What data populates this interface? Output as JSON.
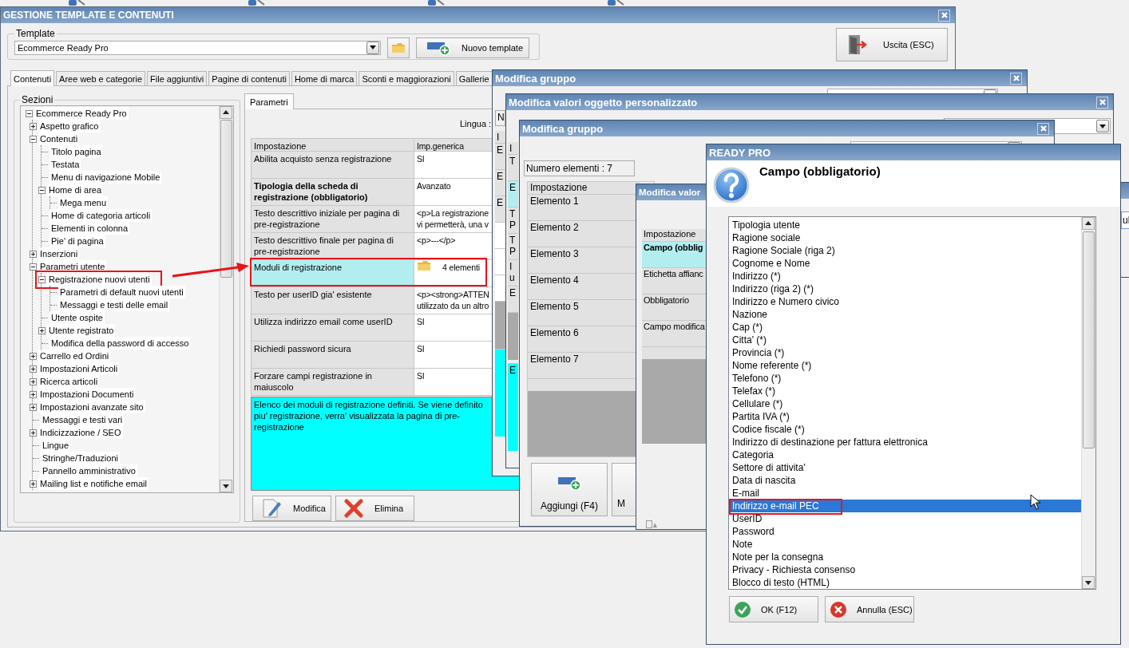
{
  "main_window": {
    "title": "GESTIONE TEMPLATE E CONTENUTI",
    "template": {
      "label": "Template",
      "value": "Ecommerce Ready Pro"
    },
    "new_template_button": "Nuovo template",
    "exit_button": "Uscita (ESC)",
    "tabs": [
      {
        "label": "Contenuti",
        "selected": true
      },
      {
        "label": "Aree web e categorie",
        "selected": false
      },
      {
        "label": "File aggiuntivi",
        "selected": false
      },
      {
        "label": "Pagine di contenuti",
        "selected": false
      },
      {
        "label": "Home di marca",
        "selected": false
      },
      {
        "label": "Sconti e maggiorazioni",
        "selected": false
      },
      {
        "label": "Gallerie",
        "selected": false
      }
    ],
    "sections": {
      "label": "Sezioni",
      "tree": [
        {
          "label": "Ecommerce Ready Pro",
          "expanded": true,
          "annotated": false,
          "children": [
            {
              "label": "Aspetto grafico",
              "expanded": false,
              "annotated": false
            },
            {
              "label": "Contenuti",
              "expanded": true,
              "annotated": false,
              "children": [
                {
                  "label": "Titolo pagina",
                  "annotated": false
                },
                {
                  "label": "Testata",
                  "annotated": false
                },
                {
                  "label": "Menu di navigazione Mobile",
                  "annotated": false
                },
                {
                  "label": "Home di area",
                  "expanded": true,
                  "annotated": false,
                  "children": [
                    {
                      "label": "Mega menu",
                      "annotated": false
                    }
                  ]
                },
                {
                  "label": "Home di categoria articoli",
                  "annotated": false
                },
                {
                  "label": "Elementi in colonna",
                  "annotated": false
                },
                {
                  "label": "Pie' di pagina",
                  "annotated": false
                }
              ]
            },
            {
              "label": "Inserzioni",
              "expanded": false,
              "annotated": false
            },
            {
              "label": "Parametri utente",
              "expanded": true,
              "annotated": false,
              "children": [
                {
                  "label": "Registrazione nuovi utenti",
                  "expanded": true,
                  "annotated": true,
                  "children": [
                    {
                      "label": "Parametri di default nuovi utenti",
                      "annotated": false
                    },
                    {
                      "label": "Messaggi e testi delle email",
                      "annotated": false
                    }
                  ]
                },
                {
                  "label": "Utente ospite",
                  "annotated": false
                },
                {
                  "label": "Utente registrato",
                  "expanded": false,
                  "annotated": false
                },
                {
                  "label": "Modifica della password di accesso",
                  "annotated": false
                }
              ]
            },
            {
              "label": "Carrello ed Ordini",
              "expanded": false,
              "annotated": false
            },
            {
              "label": "Impostazioni Articoli",
              "expanded": false,
              "annotated": false
            },
            {
              "label": "Ricerca articoli",
              "expanded": false,
              "annotated": false
            },
            {
              "label": "Impostazioni Documenti",
              "expanded": false,
              "annotated": false
            },
            {
              "label": "Impostazioni avanzate sito",
              "expanded": false,
              "annotated": false
            },
            {
              "label": "Messaggi e testi vari",
              "annotated": false
            },
            {
              "label": "Indicizzazione / SEO",
              "expanded": false,
              "annotated": false
            },
            {
              "label": "Lingue",
              "annotated": false
            },
            {
              "label": "Stringhe/Traduzioni",
              "annotated": false
            },
            {
              "label": "Pannello amministrativo",
              "annotated": false
            },
            {
              "label": "Mailing list e notifiche email",
              "expanded": false,
              "annotated": false
            }
          ]
        }
      ]
    },
    "parameters": {
      "tab": "Parametri",
      "language_label": "Lingua :",
      "columns": [
        "Impostazione",
        "Imp.generica"
      ],
      "rows": [
        {
          "setting": "Abilita acquisto senza registrazione",
          "value": "SI",
          "kind": "text",
          "bold": false,
          "selected": false,
          "annotated": false
        },
        {
          "setting": "Tipologia della scheda di registrazione (obbligatorio)",
          "value": "Avanzato",
          "kind": "text",
          "bold": true,
          "selected": false,
          "annotated": false
        },
        {
          "setting": "Testo descrittivo iniziale per pagina di pre-registrazione",
          "value": "<p>La registrazione\nvi permetterà, una v",
          "kind": "text",
          "bold": false,
          "selected": false,
          "annotated": false
        },
        {
          "setting": "Testo descrittivo finale per pagina di pre-registrazione",
          "value": "<p>---</p>",
          "kind": "text",
          "bold": false,
          "selected": false,
          "annotated": false
        },
        {
          "setting": "Moduli di registrazione",
          "value": "4 elementi",
          "kind": "folder",
          "bold": false,
          "selected": true,
          "annotated": true
        },
        {
          "setting": "Testo per userID gia' esistente",
          "value": "<p><strong>ATTEN\nutilizzato da un altro",
          "kind": "text",
          "bold": false,
          "selected": false,
          "annotated": false
        },
        {
          "setting": "Utilizza indirizzo email come userID",
          "value": "SI",
          "kind": "text",
          "bold": false,
          "selected": false,
          "annotated": false
        },
        {
          "setting": "Richiedi password sicura",
          "value": "SI",
          "kind": "text",
          "bold": false,
          "selected": false,
          "annotated": false
        },
        {
          "setting": "Forzare campi registrazione in maiuscolo",
          "value": "SI",
          "kind": "text",
          "bold": false,
          "selected": false,
          "annotated": false
        }
      ],
      "description": "Elenco dei moduli di registrazione definiti. Se viene definito piu' registrazione, verra' visualizzata la pagina di pre-registrazione",
      "buttons": [
        {
          "label": "Modifica",
          "kind": "edit"
        },
        {
          "label": "Elimina",
          "kind": "delete"
        }
      ]
    }
  },
  "dialogs": [
    {
      "kind": "strip",
      "title": "Modifica gruppo",
      "cells": [
        {
          "kind": "field",
          "text": "N"
        },
        {
          "kind": "header",
          "text": "I"
        },
        {
          "kind": "row",
          "text": "E"
        },
        {
          "kind": "row",
          "text": "E"
        },
        {
          "kind": "row",
          "text": "E"
        },
        {
          "kind": "blank"
        },
        {
          "kind": "blank"
        },
        {
          "kind": "blank"
        },
        {
          "kind": "panel"
        },
        {
          "kind": "desc"
        }
      ]
    },
    {
      "kind": "strip",
      "title": "Modifica valori oggetto personalizzato",
      "cells": [
        {
          "kind": "header",
          "text": "I"
        },
        {
          "kind": "row",
          "text": "T"
        },
        {
          "kind": "selected",
          "text": "E"
        },
        {
          "kind": "row",
          "text": "T P"
        },
        {
          "kind": "row",
          "text": "T P"
        },
        {
          "kind": "row",
          "text": "I u"
        },
        {
          "kind": "row",
          "text": "E"
        },
        {
          "kind": "panel"
        },
        {
          "kind": "desc",
          "text": "E"
        }
      ]
    },
    {
      "kind": "group",
      "title": "Modifica gruppo",
      "count": "Numero elementi : 7",
      "column": "Impostazione",
      "rows": [
        "Elemento 1",
        "Elemento 2",
        "Elemento 3",
        "Elemento 4",
        "Elemento 5",
        "Elemento 6",
        "Elemento 7"
      ],
      "buttons": [
        {
          "label": "Aggiungi (F4)",
          "kind": "add"
        },
        {
          "label": "M",
          "kind": "partial"
        }
      ]
    },
    {
      "kind": "values",
      "title": "Modifica valor",
      "column": "Impostazione",
      "rows": [
        {
          "text": "Campo (obblig",
          "bold": true,
          "selected": true
        },
        {
          "text": "Etichetta affianc",
          "bold": false,
          "selected": false
        },
        {
          "text": "Obbligatorio",
          "bold": false,
          "selected": false
        },
        {
          "text": "Campo modifica",
          "bold": false,
          "selected": false
        }
      ]
    },
    {
      "kind": "edge",
      "text": "ul"
    }
  ],
  "prompt": {
    "title": "READY PRO",
    "question": "Campo (obbligatorio)",
    "options": [
      {
        "label": "Tipologia utente",
        "selected": false,
        "annotated": false
      },
      {
        "label": "Ragione sociale",
        "selected": false,
        "annotated": false
      },
      {
        "label": "Ragione Sociale (riga 2)",
        "selected": false,
        "annotated": false
      },
      {
        "label": "Cognome e Nome",
        "selected": false,
        "annotated": false
      },
      {
        "label": "Indirizzo (*)",
        "selected": false,
        "annotated": false
      },
      {
        "label": "Indirizzo (riga 2) (*)",
        "selected": false,
        "annotated": false
      },
      {
        "label": "Indirizzo e Numero civico",
        "selected": false,
        "annotated": false
      },
      {
        "label": "Nazione",
        "selected": false,
        "annotated": false
      },
      {
        "label": "Cap (*)",
        "selected": false,
        "annotated": false
      },
      {
        "label": "Citta' (*)",
        "selected": false,
        "annotated": false
      },
      {
        "label": "Provincia (*)",
        "selected": false,
        "annotated": false
      },
      {
        "label": "Nome referente (*)",
        "selected": false,
        "annotated": false
      },
      {
        "label": "Telefono (*)",
        "selected": false,
        "annotated": false
      },
      {
        "label": "Telefax (*)",
        "selected": false,
        "annotated": false
      },
      {
        "label": "Cellulare (*)",
        "selected": false,
        "annotated": false
      },
      {
        "label": "Partita IVA (*)",
        "selected": false,
        "annotated": false
      },
      {
        "label": "Codice fiscale (*)",
        "selected": false,
        "annotated": false
      },
      {
        "label": "Indirizzo di destinazione per fattura elettronica",
        "selected": false,
        "annotated": false
      },
      {
        "label": "Categoria",
        "selected": false,
        "annotated": false
      },
      {
        "label": "Settore di attivita'",
        "selected": false,
        "annotated": false
      },
      {
        "label": "Data di nascita",
        "selected": false,
        "annotated": false
      },
      {
        "label": "E-mail",
        "selected": false,
        "annotated": false
      },
      {
        "label": "Indirizzo e-mail PEC",
        "selected": true,
        "annotated": true
      },
      {
        "label": "UserID",
        "selected": false,
        "annotated": false
      },
      {
        "label": "Password",
        "selected": false,
        "annotated": false
      },
      {
        "label": "Note",
        "selected": false,
        "annotated": false
      },
      {
        "label": "Note per la consegna",
        "selected": false,
        "annotated": false
      },
      {
        "label": "Privacy - Richiesta consenso",
        "selected": false,
        "annotated": false
      },
      {
        "label": "Blocco di testo (HTML)",
        "selected": false,
        "annotated": false
      }
    ],
    "buttons": [
      {
        "label": "OK (F12)",
        "kind": "ok"
      },
      {
        "label": "Annulla (ESC)",
        "kind": "cancel"
      }
    ]
  }
}
